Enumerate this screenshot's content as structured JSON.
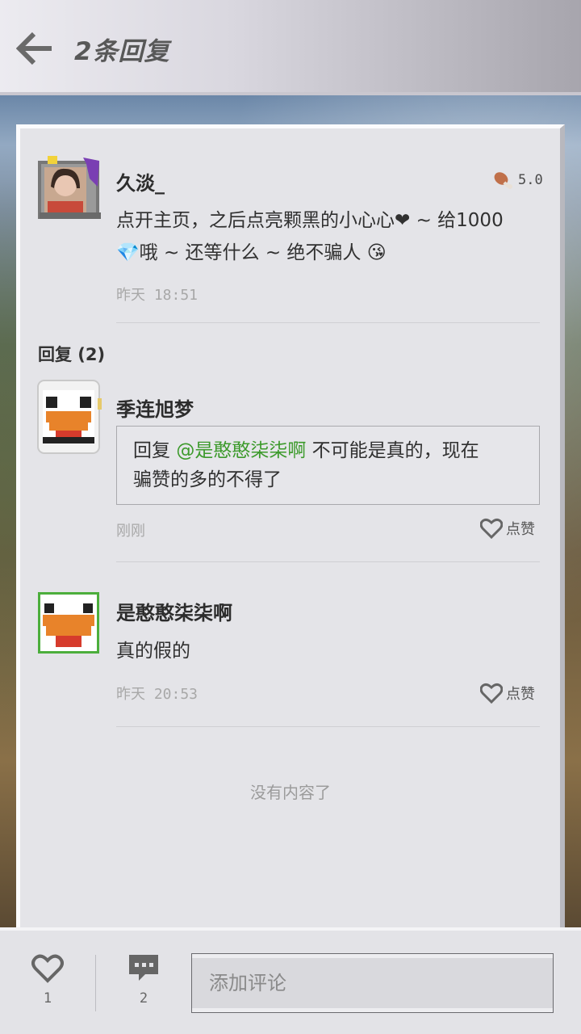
{
  "header": {
    "title": "2条回复"
  },
  "main_comment": {
    "author": "久淡_",
    "rating": "5.0",
    "text_line1": "点开主页，之后点亮颗黑的小心心❤ ~ 给1000",
    "text_line2": "💎哦 ~ 还等什么 ~ 绝不骗人 😘",
    "time": "昨天 18:51"
  },
  "replies_header": "回复 (2)",
  "replies": [
    {
      "author": "季连旭梦",
      "quote_prefix": "回复 ",
      "mention": "@是憨憨柒柒啊",
      "quote_text_1": " 不可能是真的，现在",
      "quote_text_2": "骗赞的多的不得了",
      "time": "刚刚",
      "like_label": "点赞"
    },
    {
      "author": "是憨憨柒柒啊",
      "text": "真的假的",
      "time": "昨天 20:53",
      "like_label": "点赞"
    }
  ],
  "end_text": "没有内容了",
  "bottom_bar": {
    "like_count": "1",
    "comment_count": "2",
    "comment_placeholder": "添加评论"
  },
  "colors": {
    "mention": "#3c9a2b",
    "avatar_border_green": "#4cae3c"
  },
  "icons": {
    "back": "arrow-left-icon",
    "rating": "drumstick-icon",
    "like": "heart-icon",
    "comment": "speech-bubble-icon"
  }
}
